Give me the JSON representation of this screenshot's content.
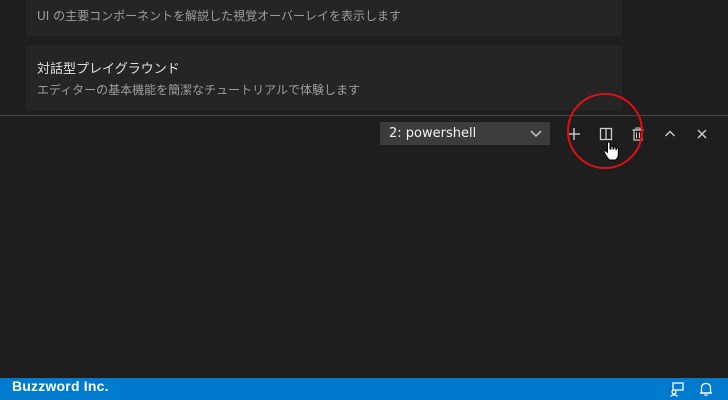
{
  "walkthrough": {
    "items": [
      {
        "description": "UI の主要コンポーネントを解説した視覚オーバーレイを表示します"
      },
      {
        "title": "対話型プレイグラウンド",
        "description": "エディターの基本機能を簡潔なチュートリアルで体験します"
      }
    ]
  },
  "terminal": {
    "selected_instance": "2: powershell",
    "icons": [
      "plus-icon",
      "split-icon",
      "trash-icon",
      "chevron-up-icon",
      "close-icon"
    ]
  },
  "status_bar": {
    "text": "Buzzword Inc.",
    "icons": [
      "feedback-icon",
      "bell-icon"
    ]
  },
  "colors": {
    "status_bar": "#007acc",
    "highlight_ring": "#e01010",
    "background": "#1e1e1e"
  }
}
